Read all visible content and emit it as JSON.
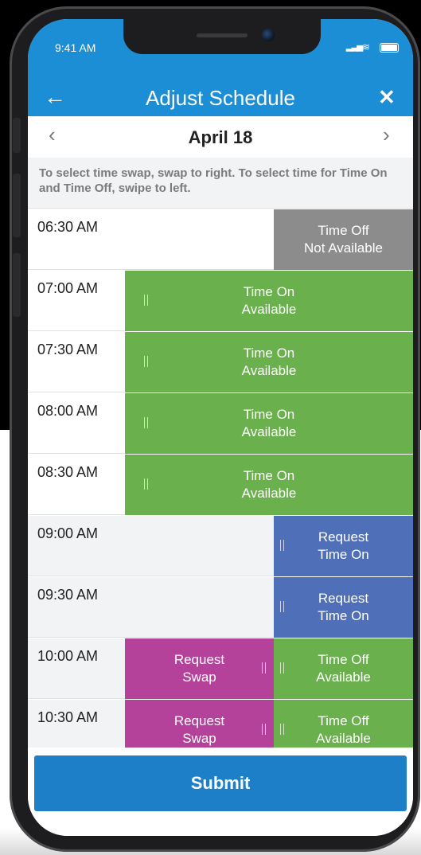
{
  "status": {
    "time": "9:41 AM"
  },
  "header": {
    "back_icon": "←",
    "title": "Adjust Schedule",
    "close_icon": "✕"
  },
  "date_nav": {
    "prev_icon": "‹",
    "date": "April 18",
    "next_icon": "›"
  },
  "instructions": "To select time swap, swap to right. To select time for Time On and Time Off, swipe to left.",
  "slots": [
    {
      "time": "06:30 AM",
      "main": null,
      "side": {
        "l1": "Time Off",
        "l2": "Not Available",
        "color": "#8c8c8c"
      }
    },
    {
      "time": "07:00 AM",
      "main": {
        "l1": "Time On",
        "l2": "Available",
        "color": "#6ab04c"
      },
      "side": null
    },
    {
      "time": "07:30 AM",
      "main": {
        "l1": "Time On",
        "l2": "Available",
        "color": "#6ab04c"
      },
      "side": null
    },
    {
      "time": "08:00 AM",
      "main": {
        "l1": "Time On",
        "l2": "Available",
        "color": "#6ab04c"
      },
      "side": null
    },
    {
      "time": "08:30 AM",
      "main": {
        "l1": "Time On",
        "l2": "Available",
        "color": "#6ab04c"
      },
      "side": null
    },
    {
      "time": "09:00 AM",
      "main": null,
      "side": {
        "l1": "Request",
        "l2": "Time On",
        "color": "#4f6fb8"
      }
    },
    {
      "time": "09:30 AM",
      "main": null,
      "side": {
        "l1": "Request",
        "l2": "Time On",
        "color": "#4f6fb8"
      }
    },
    {
      "time": "10:00 AM",
      "main": {
        "l1": "Request",
        "l2": "Swap",
        "color": "#b5429a"
      },
      "side": {
        "l1": "Time Off",
        "l2": "Available",
        "color": "#6ab04c"
      }
    },
    {
      "time": "10:30 AM",
      "main": {
        "l1": "Request",
        "l2": "Swap",
        "color": "#b5429a"
      },
      "side": {
        "l1": "Time Off",
        "l2": "Available",
        "color": "#6ab04c"
      }
    }
  ],
  "submit_label": "Submit",
  "colors": {
    "accent": "#1c8ed6",
    "submit": "#1c7fc8"
  }
}
